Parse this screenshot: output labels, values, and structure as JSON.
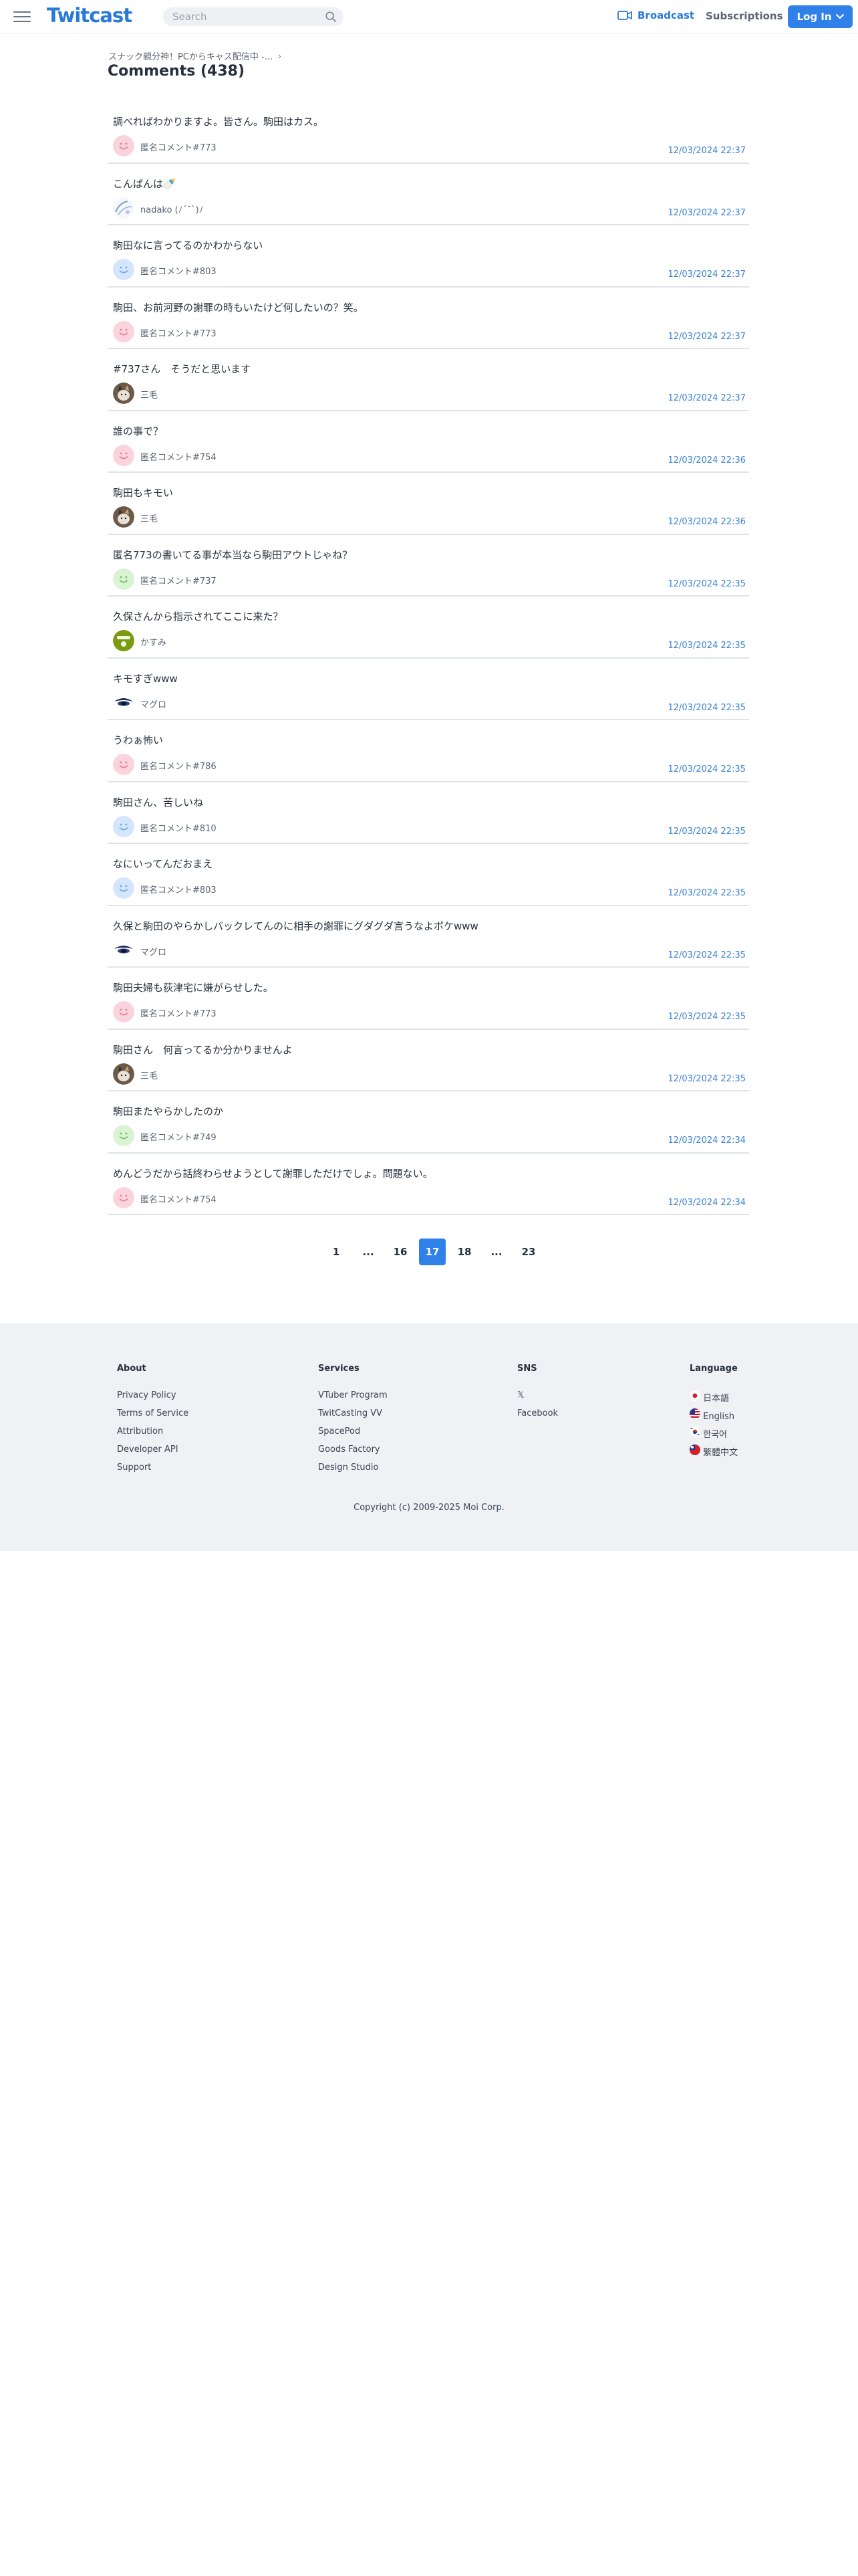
{
  "header": {
    "logo": "Twitcast",
    "search_placeholder": "Search",
    "broadcast": "Broadcast",
    "subscriptions": "Subscriptions",
    "login": "Log In",
    "brand_color": "#2979d8"
  },
  "breadcrumb": "スナック親分神！PCからキャス配信中 -...",
  "page_title": "Comments (438)",
  "comments": [
    {
      "text": "調べればわかりますよ。皆さん。駒田はカス。",
      "user": "匿名コメント#773",
      "time": "12/03/2024 22:37",
      "avatar": "anon-pink"
    },
    {
      "text": "こんばんは🍼",
      "user": "nadako (ﾉ´¯`)ﾉ",
      "time": "12/03/2024 22:37",
      "avatar": "nadako"
    },
    {
      "text": "駒田なに言ってるのかわからない",
      "user": "匿名コメント#803",
      "time": "12/03/2024 22:37",
      "avatar": "anon-blue"
    },
    {
      "text": "駒田、お前河野の謝罪の時もいたけど何したいの？笑。",
      "user": "匿名コメント#773",
      "time": "12/03/2024 22:37",
      "avatar": "anon-pink"
    },
    {
      "text": "#737さん　そうだと思います",
      "user": "三毛",
      "time": "12/03/2024 22:37",
      "avatar": "cat"
    },
    {
      "text": "誰の事で？",
      "user": "匿名コメント#754",
      "time": "12/03/2024 22:36",
      "avatar": "anon-pink"
    },
    {
      "text": "駒田もキモい",
      "user": "三毛",
      "time": "12/03/2024 22:36",
      "avatar": "cat"
    },
    {
      "text": "匿名773の書いてる事が本当なら駒田アウトじゃね？",
      "user": "匿名コメント#737",
      "time": "12/03/2024 22:35",
      "avatar": "anon-green"
    },
    {
      "text": "久保さんから指示されてここに来た？",
      "user": "かすみ",
      "time": "12/03/2024 22:35",
      "avatar": "kasumi"
    },
    {
      "text": "キモすぎwww",
      "user": "マグロ",
      "time": "12/03/2024 22:35",
      "avatar": "maguro"
    },
    {
      "text": "うわぁ怖い",
      "user": "匿名コメント#786",
      "time": "12/03/2024 22:35",
      "avatar": "anon-pink"
    },
    {
      "text": "駒田さん、苦しいね",
      "user": "匿名コメント#810",
      "time": "12/03/2024 22:35",
      "avatar": "anon-blue"
    },
    {
      "text": "なにいってんだおまえ",
      "user": "匿名コメント#803",
      "time": "12/03/2024 22:35",
      "avatar": "anon-blue"
    },
    {
      "text": "久保と駒田のやらかしバックレてんのに相手の謝罪にグダグダ言うなよボケwww",
      "user": "マグロ",
      "time": "12/03/2024 22:35",
      "avatar": "maguro"
    },
    {
      "text": "駒田夫婦も荻津宅に嫌がらせした。",
      "user": "匿名コメント#773",
      "time": "12/03/2024 22:35",
      "avatar": "anon-pink"
    },
    {
      "text": "駒田さん　何言ってるか分かりませんよ",
      "user": "三毛",
      "time": "12/03/2024 22:35",
      "avatar": "cat"
    },
    {
      "text": "駒田またやらかしたのか",
      "user": "匿名コメント#749",
      "time": "12/03/2024 22:34",
      "avatar": "anon-green"
    },
    {
      "text": "めんどうだから話終わらせようとして謝罪しただけでしょ。問題ない。",
      "user": "匿名コメント#754",
      "time": "12/03/2024 22:34",
      "avatar": "anon-pink"
    }
  ],
  "pagination": {
    "pages": [
      "1",
      "...",
      "16",
      "17",
      "18",
      "...",
      "23"
    ],
    "current": "17"
  },
  "footer": {
    "about": {
      "title": "About",
      "links": [
        "Privacy Policy",
        "Terms of Service",
        "Attribution",
        "Developer API",
        "Support"
      ]
    },
    "services": {
      "title": "Services",
      "links": [
        "VTuber Program",
        "TwitCasting VV",
        "SpacePod",
        "Goods Factory",
        "Design Studio"
      ]
    },
    "sns": {
      "title": "SNS",
      "links": [
        "𝕏",
        "Facebook"
      ]
    },
    "language": {
      "title": "Language",
      "links": [
        "日本語",
        "English",
        "한국어",
        "繁體中文"
      ]
    },
    "copyright": "Copyright (c) 2009-2025 Moi Corp."
  }
}
